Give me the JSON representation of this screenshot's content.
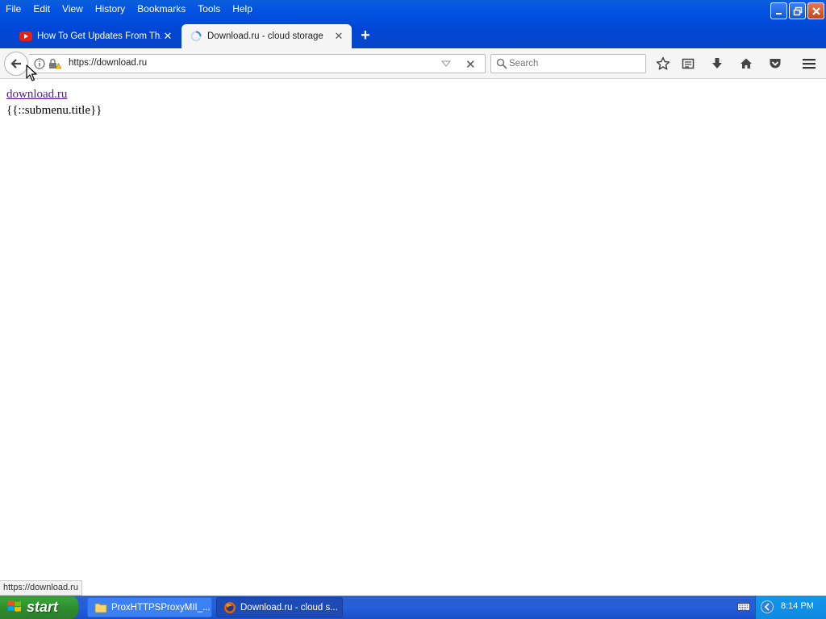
{
  "menubar": {
    "items": [
      "File",
      "Edit",
      "View",
      "History",
      "Bookmarks",
      "Tools",
      "Help"
    ]
  },
  "tabs": [
    {
      "label": "How To Get Updates From Th...",
      "icon": "youtube-icon",
      "active": false
    },
    {
      "label": "Download.ru - cloud storage",
      "icon": "loading-spinner-icon",
      "active": true
    }
  ],
  "navbar": {
    "url": "https://download.ru",
    "search_placeholder": "Search"
  },
  "content": {
    "link_text": "download.ru",
    "submenu_text": "{{::submenu.title}}",
    "status_url": "https://download.ru"
  },
  "taskbar": {
    "start_label": "start",
    "tasks": [
      {
        "label": "ProxHTTPSProxyMII_...",
        "icon": "folder-icon"
      },
      {
        "label": "Download.ru - cloud s...",
        "icon": "firefox-icon"
      }
    ],
    "clock": "8:14 PM"
  },
  "colors": {
    "titlebar": "#0454e3",
    "start_green": "#37a237",
    "taskbar_blue": "#245edb",
    "tray_blue": "#1296ea",
    "link_visited": "#551a8b"
  }
}
